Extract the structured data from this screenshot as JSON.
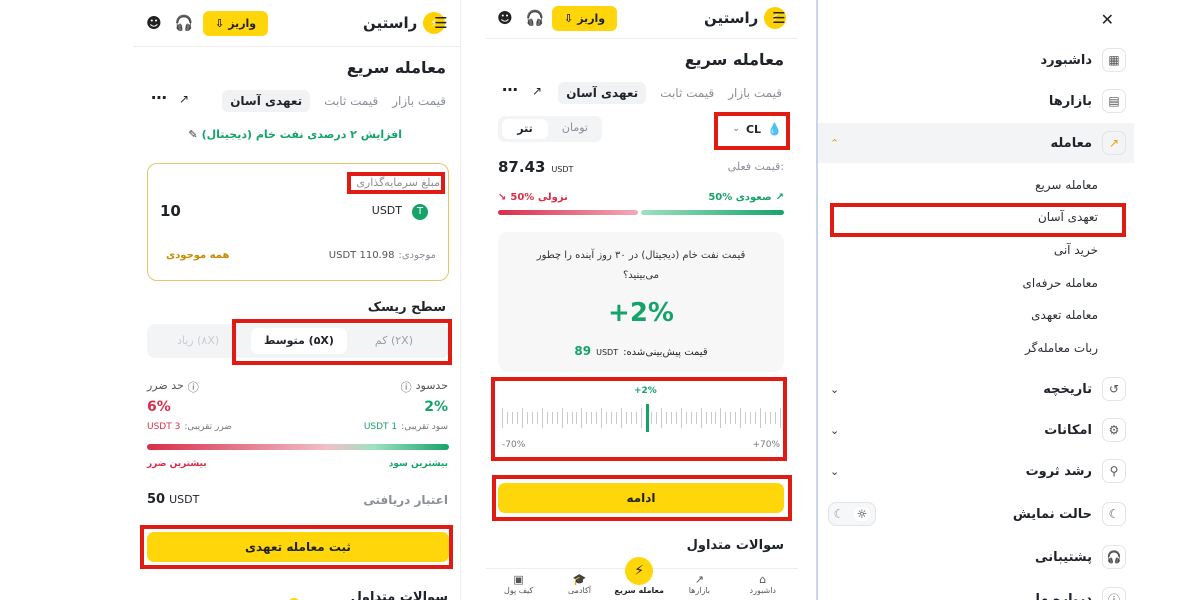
{
  "left": {
    "header": {
      "deposit_label": "واریز",
      "logo_text": "راستین"
    },
    "title": "معامله سریع",
    "tabs": [
      "قیمت بازار",
      "قیمت ثابت",
      "تعهدی آسان"
    ],
    "promo": "افزایش ۲ درصدی نفت خام (دیجیتال)",
    "invest": {
      "label": "مبلغ سرمایه‌گذاری",
      "amount": "10",
      "currency": "USDT",
      "balance_label": "موجودی:",
      "balance_value": "110.98 USDT",
      "all_balance": "همه موجودی"
    },
    "risk": {
      "title": "سطح ریسک",
      "options": [
        "کم (۲X)",
        "متوسط (۵X)",
        "زیاد (۸X)"
      ]
    },
    "limits": {
      "tp_label": "حدسود",
      "tp_value": "2%",
      "tp_desc": "سود تقریبی:",
      "tp_amount": "1 USDT",
      "sl_label": "حد ضرر",
      "sl_value": "6%",
      "sl_desc": "ضرر تقریبی:",
      "sl_amount": "3 USDT",
      "max_profit": "بیشترین سود",
      "max_loss": "بیشترین ضرر"
    },
    "credit": {
      "label": "اعتبار دریافتی",
      "value": "50",
      "currency": "USDT"
    },
    "submit_label": "ثبت معامله تعهدی",
    "faq_title": "سوالات متداول"
  },
  "middle": {
    "header": {
      "deposit_label": "واریز",
      "logo_text": "راستین"
    },
    "title": "معامله سریع",
    "tabs": [
      "قیمت بازار",
      "قیمت ثابت",
      "تعهدی آسان"
    ],
    "asset": "CL",
    "currency_tabs": [
      "تومان",
      "تتر"
    ],
    "current_price_label": "قیمت فعلی:",
    "current_price": "87.43",
    "current_currency": "USDT",
    "up_label": "50% صعودی",
    "down_label": "50% نزولی",
    "prediction": {
      "question": "قیمت نفت خام (دیجیتال) در ۳۰ روز آینده را چطور می‌بینید؟",
      "percent": "+2%",
      "predicted_label": "قیمت پیش‌بینی‌شده:",
      "predicted_currency": "USDT",
      "predicted_value": "89"
    },
    "slider": {
      "value_label": "+2%",
      "min_label": "-70%",
      "max_label": "+70%",
      "value": 2
    },
    "continue_label": "ادامه",
    "faq_title": "سوالات متداول",
    "bottom_nav": [
      "داشبورد",
      "بازارها",
      "معامله سریع",
      "آکادمی",
      "کیف پول"
    ]
  },
  "sidebar": {
    "items": [
      {
        "label": "داشبورد",
        "icon": "dashboard-icon"
      },
      {
        "label": "بازارها",
        "icon": "markets-icon"
      },
      {
        "label": "معامله",
        "icon": "chart-icon"
      },
      {
        "label": "تاریخچه",
        "icon": "history-icon"
      },
      {
        "label": "امکانات",
        "icon": "features-icon"
      },
      {
        "label": "رشد ثروت",
        "icon": "wealth-icon"
      },
      {
        "label": "حالت نمایش",
        "icon": "theme-icon"
      },
      {
        "label": "پشتیبانی",
        "icon": "support-icon"
      },
      {
        "label": "درباره ما",
        "icon": "about-icon"
      }
    ],
    "sub_items": [
      "معامله سریع",
      "تعهدی آسان",
      "خرید آنی",
      "معامله حرفه‌ای",
      "معامله تعهدی",
      "ربات معامله‌گر"
    ]
  },
  "colors": {
    "accent": "#ffd60a",
    "green": "#16a36a",
    "red": "#d92d4a",
    "highlight": "#e01b14"
  }
}
